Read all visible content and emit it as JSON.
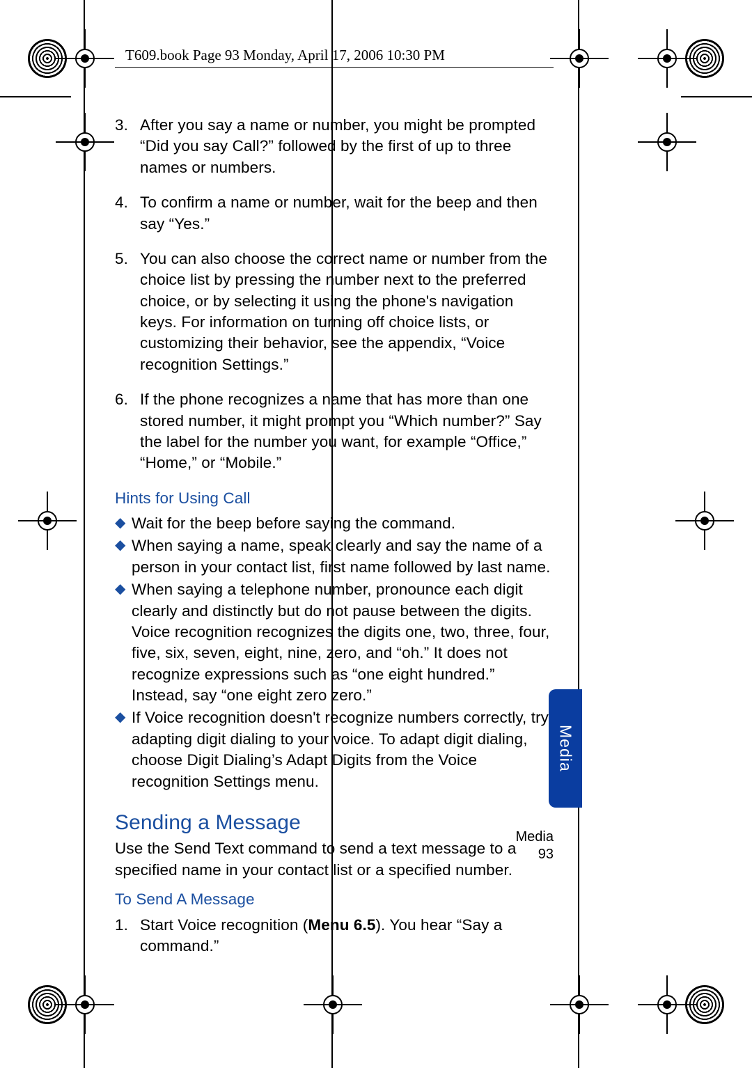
{
  "running_head": "T609.book  Page 93  Monday, April 17, 2006  10:30 PM",
  "numbered": [
    {
      "n": "3.",
      "t": "After you say a name or number, you might be prompted “Did you say Call?” followed by the first of up to three names or numbers."
    },
    {
      "n": "4.",
      "t": "To confirm a name or number, wait for the beep and then say “Yes.”"
    },
    {
      "n": "5.",
      "t": "You can also choose the correct name or number from the choice list by pressing the number next to the preferred choice, or by selecting it using the phone's navigation keys. For information on turning off choice lists, or customizing their behavior, see the appendix, “Voice recognition Settings.”"
    },
    {
      "n": "6.",
      "t": "If the phone recognizes a name that has more than one stored number, it might prompt you “Which number?” Say the label for the number you want, for example “Office,” “Home,” or “Mobile.”"
    }
  ],
  "hints_heading": "Hints for Using Call",
  "hints": [
    "Wait for the beep before saying the command.",
    "When saying a name, speak clearly and say the name of a person in your contact list, first name followed by last name.",
    "When saying a telephone number, pronounce each digit clearly and distinctly but do not pause between the digits. Voice recognition recognizes the digits one, two, three, four, five, six, seven, eight, nine, zero, and “oh.” It does not recognize expressions such as “one eight hundred.” Instead, say “one eight zero zero.”",
    "If Voice recognition doesn't recognize numbers correctly, try adapting digit dialing to your voice. To adapt digit dialing, choose Digit Dialing’s Adapt Digits from the Voice recognition Settings menu."
  ],
  "sending_heading": "Sending a Message",
  "sending_para": "Use the Send Text command to send a text message to a specified name in your contact list or a specified number.",
  "to_send_heading": "To Send A Message",
  "to_send_step_num": "1.",
  "to_send_step_pre": "Start Voice recognition (",
  "to_send_step_menu": "Menu 6.5",
  "to_send_step_post": "). You hear “Say a command.”",
  "side_tab": "Media",
  "footer_section": "Media",
  "footer_page": "93"
}
